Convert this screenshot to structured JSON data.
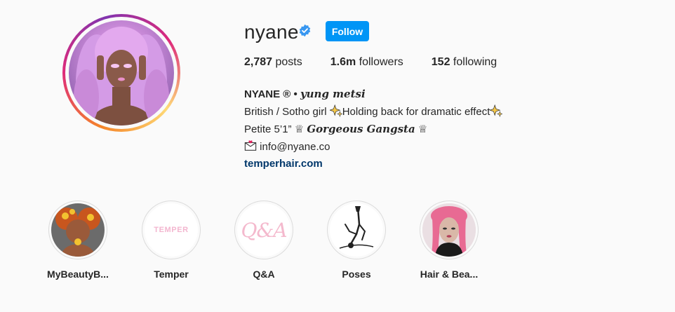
{
  "profile": {
    "username": "nyane",
    "follow_label": "Follow",
    "stats": {
      "posts_count": "2,787",
      "posts_label": " posts",
      "followers_count": "1.6m",
      "followers_label": " followers",
      "following_count": "152",
      "following_label": " following"
    },
    "bio": {
      "name": "NYANE ® • ",
      "name_fancy": "yung metsi",
      "line2_a": "British / Sotho girl ",
      "line2_b": "Holding back for dramatic effect",
      "line3_a": "Petite 5’1” ♕ ",
      "line3_fancy": "Gorgeous Gangsta",
      "line3_b": " ♕",
      "email": " info@nyane.co",
      "website": "temperhair.com"
    }
  },
  "highlights": [
    {
      "label": "MyBeautyB..."
    },
    {
      "label": "Temper",
      "logo_text": "TEMPER"
    },
    {
      "label": "Q&A",
      "cover_text": "Q&A"
    },
    {
      "label": "Poses"
    },
    {
      "label": "Hair & Bea..."
    }
  ],
  "colors": {
    "follow_button": "#0095f6",
    "verified_badge": "#3897f0",
    "link": "#00376b"
  },
  "icons": [
    "verified-badge-icon",
    "sparkles-icon",
    "crown-icon",
    "envelope-icon"
  ]
}
